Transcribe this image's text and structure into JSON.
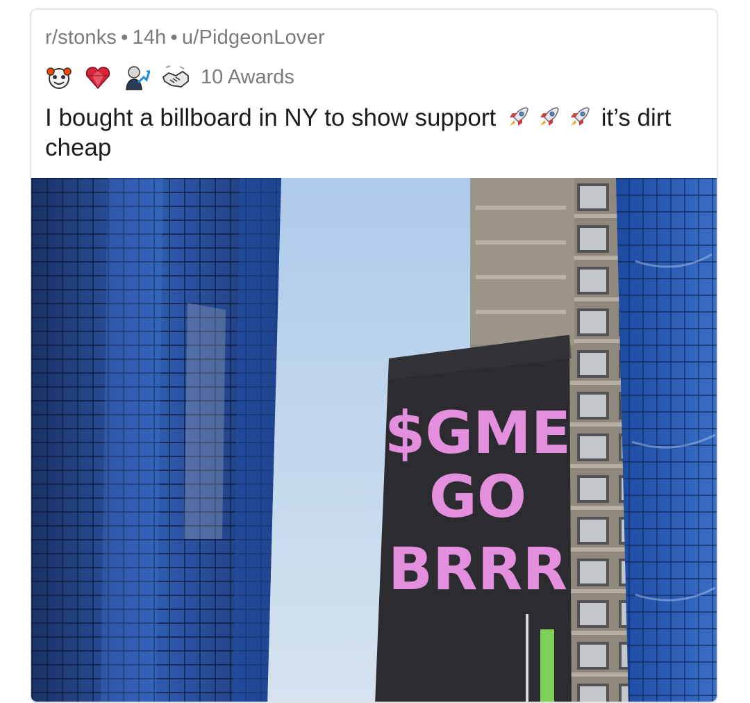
{
  "post": {
    "subreddit": "r/stonks",
    "age": "14h",
    "author": "u/PidgeonLover",
    "awards_label": "10 Awards",
    "awards": [
      {
        "icon": "wholesome-seal-icon"
      },
      {
        "icon": "heart-gem-icon"
      },
      {
        "icon": "stonks-man-icon"
      },
      {
        "icon": "handshake-icon"
      }
    ],
    "title_before": "I bought a billboard in NY to show support",
    "title_emoji": [
      "rocket-icon",
      "rocket-icon",
      "rocket-icon"
    ],
    "title_after": "it’s dirt cheap"
  },
  "image": {
    "billboard_lines": [
      "$GME",
      "GO",
      "BRRR"
    ],
    "colors": {
      "sky": "#b8d0e8",
      "glass": "#2a4f9a",
      "billboard": "#2a2a2e",
      "billboard_text": "#e38fdd",
      "stone": "#a09a8e"
    }
  }
}
